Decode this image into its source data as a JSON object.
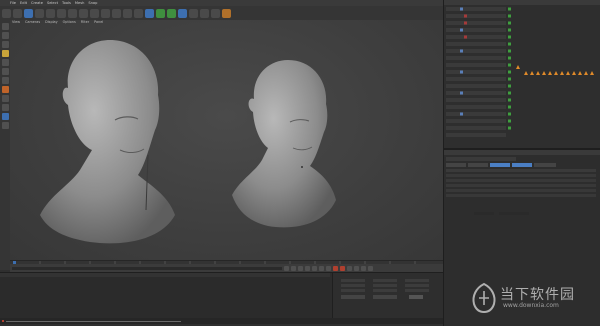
{
  "menubar": {
    "items": [
      "File",
      "Edit",
      "Create",
      "Select",
      "Tools",
      "Mesh",
      "Snap"
    ]
  },
  "viewport": {
    "menu": [
      "View",
      "Cameras",
      "Display",
      "Options",
      "Filter",
      "Panel"
    ]
  },
  "watermark": {
    "cn": "当下软件园",
    "url": "www.downxia.com"
  },
  "colors": {
    "accent": "#3d6fb0",
    "ok": "#3fa03f",
    "warn": "#e08a2a"
  }
}
